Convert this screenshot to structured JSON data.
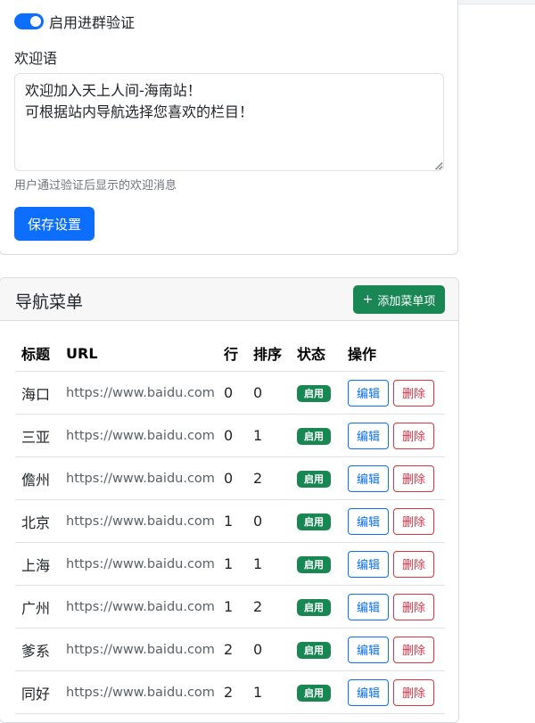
{
  "group_verify": {
    "toggle_label": "启用进群验证",
    "enabled": true
  },
  "welcome": {
    "label": "欢迎语",
    "value": "欢迎加入天上人间-海南站！\n可根据站内导航选择您喜欢的栏目！",
    "help": "用户通过验证后显示的欢迎消息",
    "save_label": "保存设置"
  },
  "nav_menu": {
    "title": "导航菜单",
    "add_label": "添加菜单项",
    "add_icon": "plus-icon",
    "columns": [
      "标题",
      "URL",
      "行",
      "排序",
      "状态",
      "操作"
    ],
    "edit_label": "编辑",
    "delete_label": "删除",
    "rows": [
      {
        "title": "海口",
        "url": "https://www.baidu.com",
        "row": "0",
        "order": "0",
        "status": "启用"
      },
      {
        "title": "三亚",
        "url": "https://www.baidu.com",
        "row": "0",
        "order": "1",
        "status": "启用"
      },
      {
        "title": "儋州",
        "url": "https://www.baidu.com",
        "row": "0",
        "order": "2",
        "status": "启用"
      },
      {
        "title": "北京",
        "url": "https://www.baidu.com",
        "row": "1",
        "order": "0",
        "status": "启用"
      },
      {
        "title": "上海",
        "url": "https://www.baidu.com",
        "row": "1",
        "order": "1",
        "status": "启用"
      },
      {
        "title": "广州",
        "url": "https://www.baidu.com",
        "row": "1",
        "order": "2",
        "status": "启用"
      },
      {
        "title": "爹系",
        "url": "https://www.baidu.com",
        "row": "2",
        "order": "0",
        "status": "启用"
      },
      {
        "title": "同好",
        "url": "https://www.baidu.com",
        "row": "2",
        "order": "1",
        "status": "启用"
      }
    ]
  },
  "colors": {
    "primary": "#0d6efd",
    "success": "#198754",
    "danger": "#dc3545"
  }
}
